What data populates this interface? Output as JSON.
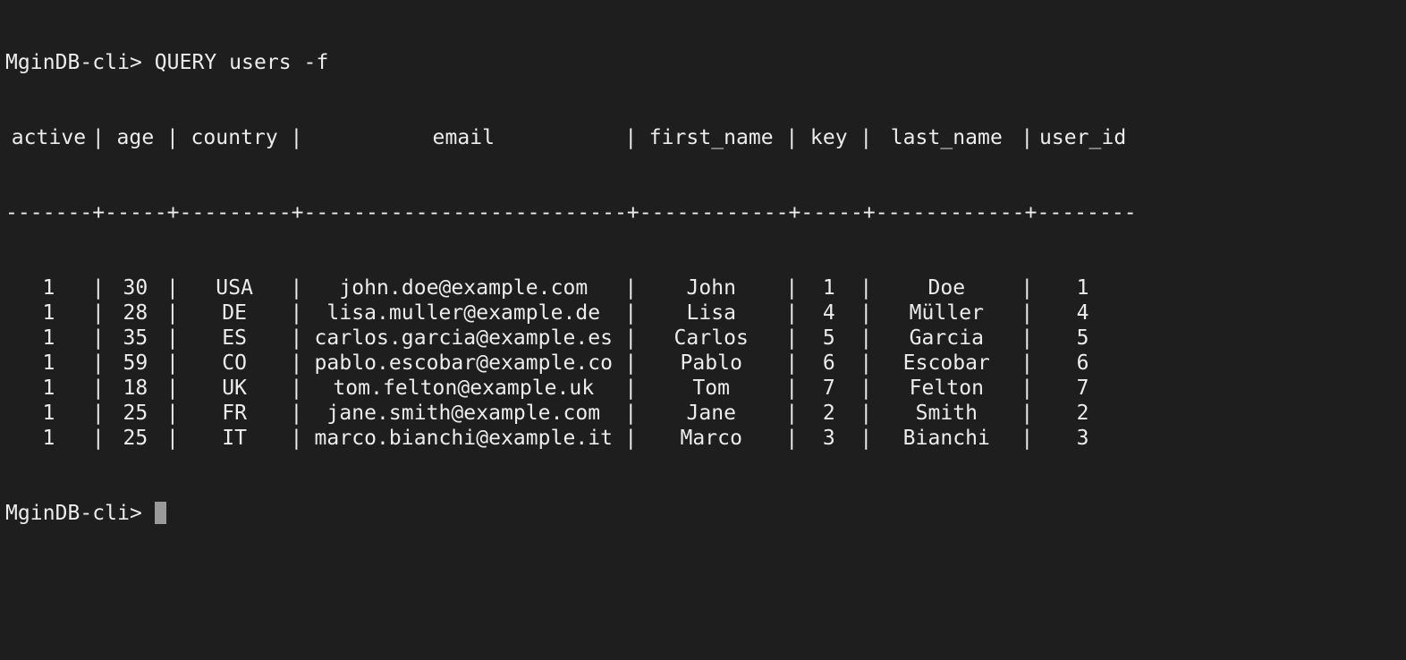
{
  "terminal": {
    "prompt": "MginDB-cli> ",
    "command": "QUERY users -f",
    "columns": [
      "active",
      "age",
      "country",
      "email",
      "first_name",
      "key",
      "last_name",
      "user_id"
    ],
    "separator": "-------+-----+---------+--------------------------+------------+-----+------------+--------",
    "rows": [
      [
        "1",
        "30",
        "USA",
        "john.doe@example.com",
        "John",
        "1",
        "Doe",
        "1"
      ],
      [
        "1",
        "28",
        "DE",
        "lisa.muller@example.de",
        "Lisa",
        "4",
        "Müller",
        "4"
      ],
      [
        "1",
        "35",
        "ES",
        "carlos.garcia@example.es",
        "Carlos",
        "5",
        "Garcia",
        "5"
      ],
      [
        "1",
        "59",
        "CO",
        "pablo.escobar@example.co",
        "Pablo",
        "6",
        "Escobar",
        "6"
      ],
      [
        "1",
        "18",
        "UK",
        "tom.felton@example.uk",
        "Tom",
        "7",
        "Felton",
        "7"
      ],
      [
        "1",
        "25",
        "FR",
        "jane.smith@example.com",
        "Jane",
        "2",
        "Smith",
        "2"
      ],
      [
        "1",
        "25",
        "IT",
        "marco.bianchi@example.it",
        "Marco",
        "3",
        "Bianchi",
        "3"
      ]
    ],
    "colors": {
      "background": "#1e1e1e",
      "text": "#ececec",
      "cursor": "#9a9a9a"
    }
  }
}
